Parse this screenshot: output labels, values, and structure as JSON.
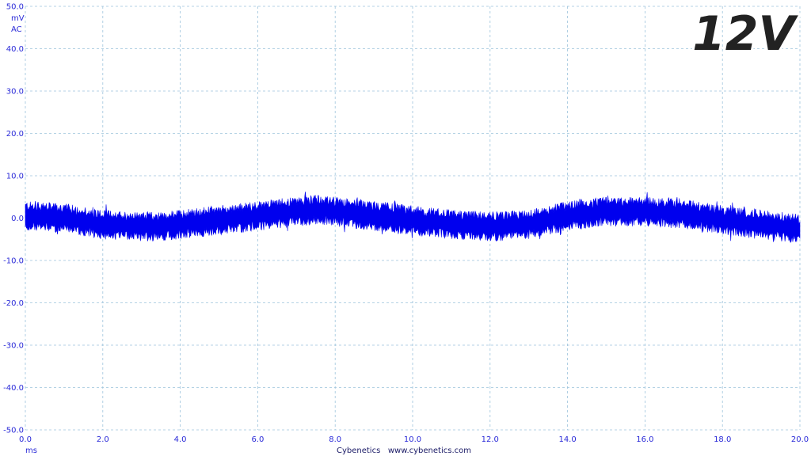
{
  "chart_data": {
    "type": "line",
    "title": "12V",
    "ylabel_unit": "mV",
    "ylabel_coupling": "AC",
    "xlabel_unit": "ms",
    "footer": "Cybenetics   www.cybenetics.com",
    "xlim": [
      0.0,
      20.0
    ],
    "ylim": [
      -50.0,
      50.0
    ],
    "x_ticks": [
      "0.0",
      "2.0",
      "4.0",
      "6.0",
      "8.0",
      "10.0",
      "12.0",
      "14.0",
      "16.0",
      "18.0",
      "20.0"
    ],
    "y_ticks": [
      "50.0",
      "40.0",
      "30.0",
      "20.0",
      "10.0",
      "0.0",
      "-10.0",
      "-20.0",
      "-30.0",
      "-40.0",
      "-50.0"
    ],
    "grid": true,
    "series": [
      {
        "color": "#0000ee",
        "x": [
          0.0,
          1.0,
          2.0,
          3.0,
          3.5,
          4.0,
          5.0,
          6.0,
          7.0,
          7.5,
          8.0,
          9.0,
          10.0,
          11.0,
          12.0,
          13.0,
          14.0,
          15.0,
          16.0,
          17.0,
          18.0,
          19.0,
          20.0
        ],
        "mean": [
          0.5,
          0.0,
          -1.5,
          -2.0,
          -2.0,
          -1.5,
          -0.5,
          0.5,
          1.5,
          2.0,
          1.5,
          0.5,
          -0.5,
          -1.5,
          -2.0,
          -1.5,
          0.5,
          1.5,
          1.5,
          1.0,
          -0.5,
          -1.5,
          -2.5
        ],
        "band_halfwidth_mV": 3.5
      }
    ]
  }
}
